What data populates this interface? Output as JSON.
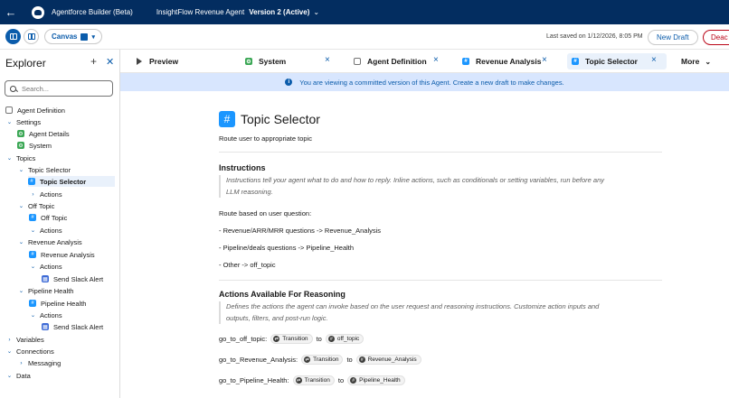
{
  "header": {
    "app_title": "Agentforce Builder (Beta)",
    "agent_name": "InsightFlow Revenue Agent",
    "version": "Version 2 (Active)"
  },
  "toolbar": {
    "canvas_label": "Canvas",
    "last_saved": "Last saved on 1/12/2026, 8:05 PM",
    "new_draft_label": "New Draft",
    "deactivate_label": "Deac"
  },
  "explorer": {
    "title": "Explorer",
    "search_placeholder": "Search...",
    "items": [
      {
        "label": "Agent Definition",
        "icon": "document-icon"
      },
      {
        "label": "Settings"
      },
      {
        "label": "Agent Details",
        "icon": "gear-icon"
      },
      {
        "label": "System",
        "icon": "gear-icon"
      },
      {
        "label": "Topics"
      },
      {
        "label": "Topic Selector"
      },
      {
        "label": "Topic Selector",
        "icon": "hash-icon"
      },
      {
        "label": "Actions"
      },
      {
        "label": "Off Topic"
      },
      {
        "label": "Off Topic",
        "icon": "hash-icon"
      },
      {
        "label": "Actions"
      },
      {
        "label": "Revenue Analysis"
      },
      {
        "label": "Revenue Analysis",
        "icon": "hash-icon"
      },
      {
        "label": "Actions"
      },
      {
        "label": "Send Slack Alert",
        "icon": "slack-icon"
      },
      {
        "label": "Pipeline Health"
      },
      {
        "label": "Pipeline Health",
        "icon": "hash-icon"
      },
      {
        "label": "Actions"
      },
      {
        "label": "Send Slack Alert",
        "icon": "slack-icon"
      },
      {
        "label": "Variables"
      },
      {
        "label": "Connections"
      },
      {
        "label": "Messaging"
      },
      {
        "label": "Data"
      }
    ]
  },
  "tabs": [
    {
      "label": "Preview"
    },
    {
      "label": "System"
    },
    {
      "label": "Agent Definition"
    },
    {
      "label": "Revenue Analysis"
    },
    {
      "label": "Topic Selector"
    },
    {
      "label": "More"
    }
  ],
  "banner": {
    "text": "You are viewing a committed version of this Agent. Create a new draft to make changes."
  },
  "topic": {
    "title": "Topic Selector",
    "description": "Route user to appropriate topic",
    "instructions_title": "Instructions",
    "instructions_help": "Instructions tell your agent what to do and how to reply. Inline actions, such as conditionals or setting variables, run before any LLM reasoning.",
    "lines": [
      "Route based on user question:",
      "- Revenue/ARR/MRR questions -> Revenue_Analysis",
      "- Pipeline/deals questions -> Pipeline_Health",
      "- Other -> off_topic"
    ],
    "actions_title": "Actions Available For Reasoning",
    "actions_help": "Defines the actions the agent can invoke based on the user request and reasoning instructions. Customize action inputs and outputs, filters, and post-run logic.",
    "actions": [
      {
        "name": "go_to_off_topic:",
        "type": "Transition",
        "to": "to",
        "target": "off_topic"
      },
      {
        "name": "go_to_Revenue_Analysis:",
        "type": "Transition",
        "to": "to",
        "target": "Revenue_Analysis"
      },
      {
        "name": "go_to_Pipeline_Health:",
        "type": "Transition",
        "to": "to",
        "target": "Pipeline_Health"
      }
    ]
  },
  "colors": {
    "header_bg": "#032d60",
    "accent": "#0b5cab",
    "banner_bg": "#d8e6fe",
    "danger": "#ba0517"
  }
}
